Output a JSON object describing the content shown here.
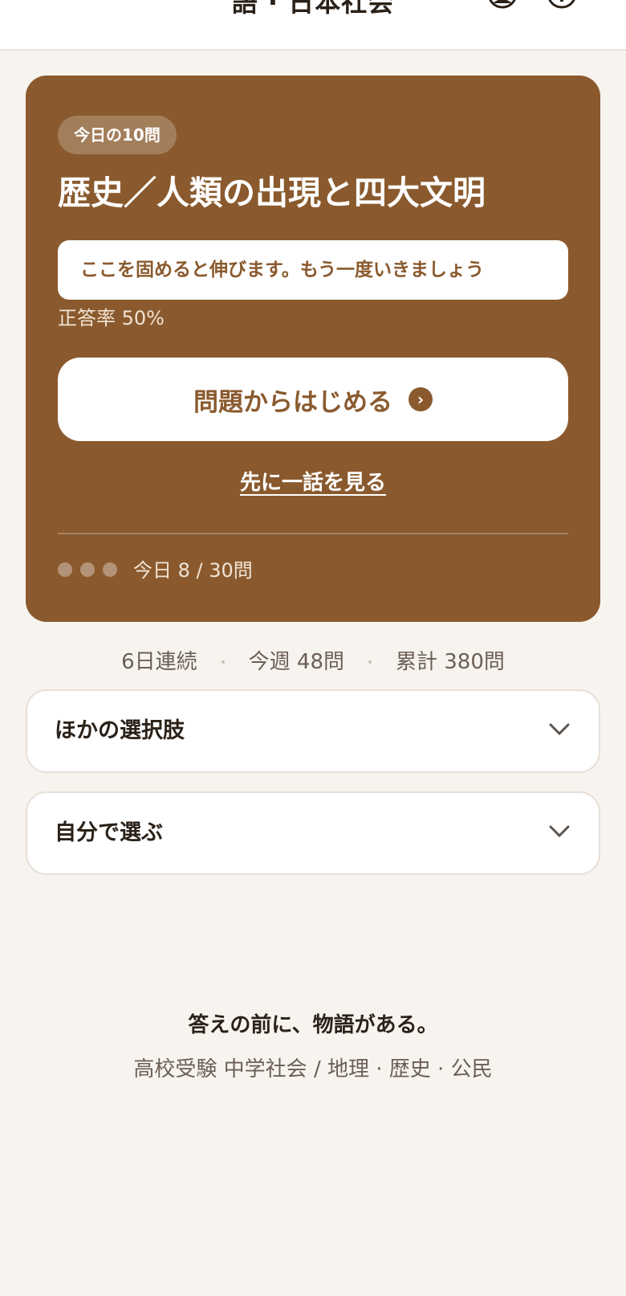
{
  "header": {
    "title": "語 · 日本社会",
    "icons": [
      "user-icon",
      "info-icon"
    ]
  },
  "card": {
    "pill": "今日の10問",
    "title": "歴史／人類の出現と四大文明",
    "hint": "ここを固めると伸びます。もう一度いきましょう",
    "accuracy": "正答率 50%",
    "start_button": "問題からはじめる",
    "story_link": "先に一話を見る",
    "progress_text": "今日 8 / 30問",
    "dots": 3
  },
  "stats": {
    "streak": "6日連続",
    "week": "今週 48問",
    "total": "累計 380問"
  },
  "accordions": [
    {
      "label": "ほかの選択肢"
    },
    {
      "label": "自分で選ぶ"
    }
  ],
  "footer": {
    "tagline": "答えの前に、物語がある。",
    "subtitle": "高校受験 中学社会 / 地理 · 歴史 · 公民"
  },
  "colors": {
    "accent": "#8a5a2e",
    "background": "#f7f3ef"
  }
}
